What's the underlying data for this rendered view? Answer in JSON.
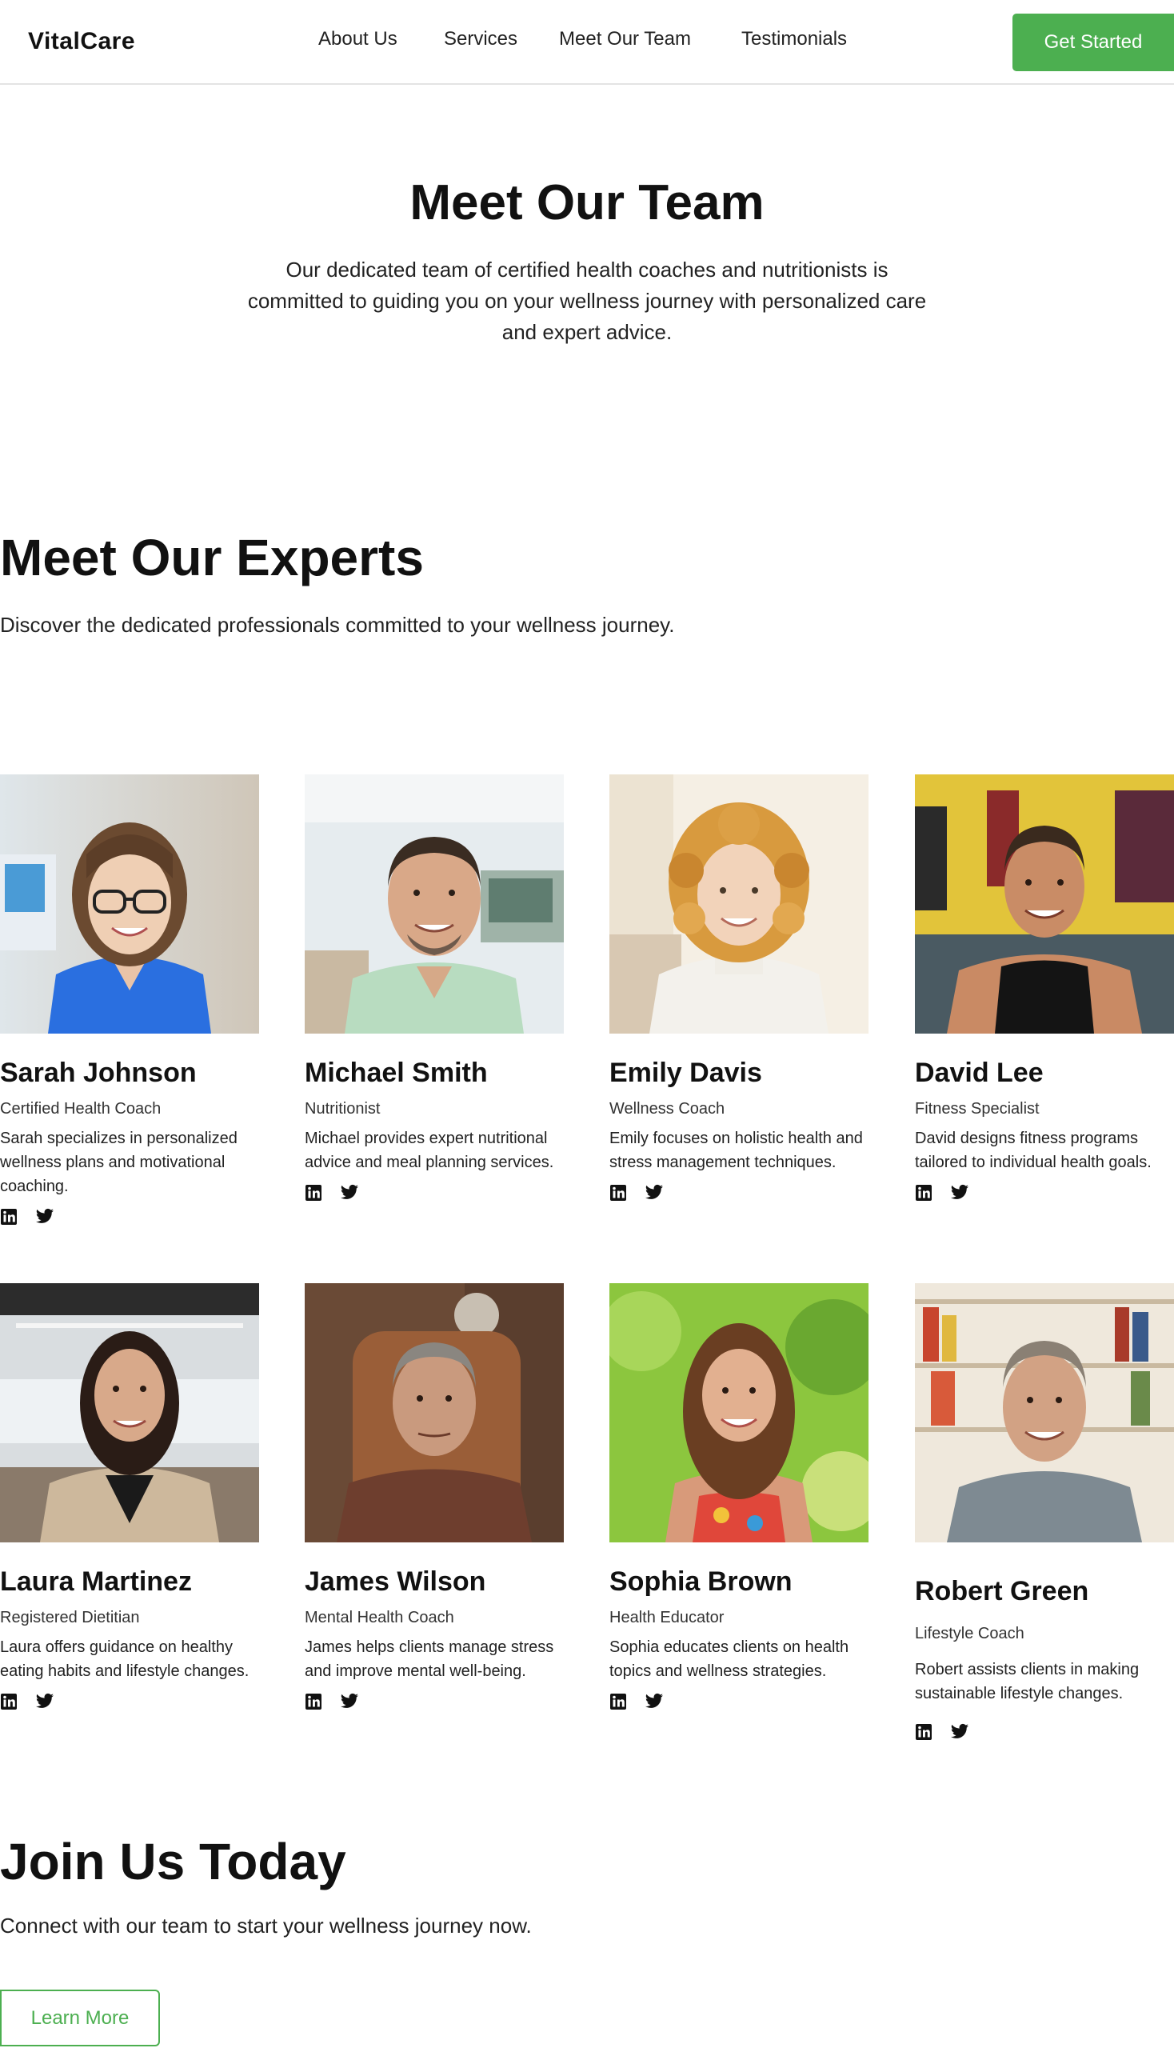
{
  "brand": {
    "name": "VitalCare",
    "accent": "#4caf50"
  },
  "nav": {
    "items": [
      "About Us",
      "Services",
      "Meet Our Team",
      "Testimonials"
    ],
    "cta": "Get Started"
  },
  "hero": {
    "title": "Meet Our Team",
    "subtitle": "Our dedicated team of certified health coaches and nutritionists is committed to guiding you on your wellness journey with personalized care and expert advice."
  },
  "experts": {
    "title": "Meet Our Experts",
    "subtitle": "Discover the dedicated professionals committed to your wellness journey.",
    "members": [
      {
        "name": "Sarah Johnson",
        "role": "Certified Health Coach",
        "bio": "Sarah specializes in personalized wellness plans and motivational coaching.",
        "photo": "woman-with-glasses-portrait"
      },
      {
        "name": "Michael Smith",
        "role": "Nutritionist",
        "bio": "Michael provides expert nutritional advice and meal planning services.",
        "photo": "smiling-man-office-portrait"
      },
      {
        "name": "Emily Davis",
        "role": "Wellness Coach",
        "bio": "Emily focuses on holistic health and stress management techniques.",
        "photo": "curly-haired-woman-portrait"
      },
      {
        "name": "David Lee",
        "role": "Fitness Specialist",
        "bio": "David designs fitness programs tailored to individual health goals.",
        "photo": "man-in-gym-portrait"
      },
      {
        "name": "Laura Martinez",
        "role": "Registered Dietitian",
        "bio": "Laura offers guidance on healthy eating habits and lifestyle changes.",
        "photo": "woman-in-blazer-portrait"
      },
      {
        "name": "James Wilson",
        "role": "Mental Health Coach",
        "bio": "James helps clients manage stress and improve mental well-being.",
        "photo": "older-man-armchair-portrait"
      },
      {
        "name": "Sophia Brown",
        "role": "Health Educator",
        "bio": "Sophia educates clients on health topics and wellness strategies.",
        "photo": "woman-outdoors-portrait"
      },
      {
        "name": "Robert Green",
        "role": "Lifestyle Coach",
        "bio": "Robert assists clients in making sustainable lifestyle changes.",
        "photo": "man-bookshelf-portrait"
      }
    ],
    "social_icons": [
      "linkedin-icon",
      "twitter-icon"
    ]
  },
  "join": {
    "title": "Join Us Today",
    "subtitle": "Connect with our team to start your wellness journey now.",
    "button": "Learn More"
  }
}
